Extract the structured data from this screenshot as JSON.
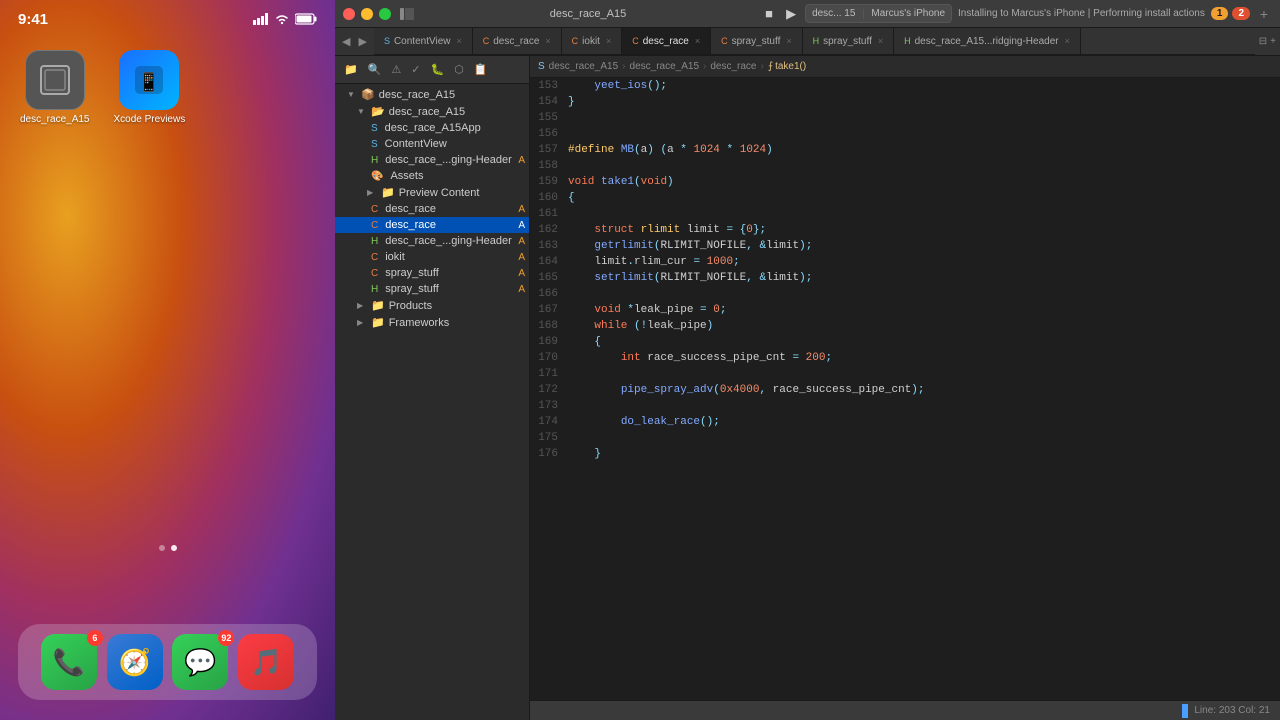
{
  "ios": {
    "status_bar": {
      "time": "9:41",
      "signal_bars": "●●●●",
      "wifi": "wifi",
      "battery": "battery"
    },
    "apps": [
      {
        "id": "desc_race_a15",
        "label": "desc_race_A15",
        "color": "#555",
        "icon": "🔲",
        "badge": null
      },
      {
        "id": "xcode_previews",
        "label": "Xcode Previews",
        "color": "#0078d4",
        "icon": "📱",
        "badge": null
      }
    ],
    "dock": [
      {
        "id": "phone",
        "icon": "📞",
        "color": "#30d158",
        "badge": "6"
      },
      {
        "id": "safari",
        "icon": "🧭",
        "color": "#0066cc",
        "badge": null
      },
      {
        "id": "messages",
        "icon": "💬",
        "color": "#30d158",
        "badge": "92"
      },
      {
        "id": "music",
        "icon": "🎵",
        "color": "#fc3c44",
        "badge": null
      }
    ]
  },
  "xcode": {
    "window_title": "desc_race_A15",
    "traffic_lights": {
      "red": "#ff5f57",
      "yellow": "#febc2e",
      "green": "#28c840"
    },
    "toolbar": {
      "stop_label": "■",
      "play_label": "▶",
      "scheme": "desc_race_A15",
      "device": "desc... 15",
      "target": "Marcus's iPhone",
      "status": "Installing to Marcus's iPhone | Performing install actions",
      "warning_count": "1",
      "error_count": "2"
    },
    "sidebar": {
      "root": "desc_race_A15",
      "items": [
        {
          "level": 0,
          "label": "desc_race_A15",
          "type": "folder",
          "expanded": true,
          "badge": ""
        },
        {
          "level": 1,
          "label": "desc_race_A15",
          "type": "folder",
          "expanded": true,
          "badge": ""
        },
        {
          "level": 2,
          "label": "desc_race_A15App",
          "type": "swift",
          "badge": ""
        },
        {
          "level": 2,
          "label": "ContentView",
          "type": "swift",
          "badge": ""
        },
        {
          "level": 2,
          "label": "desc_race_...ging-Header",
          "type": "h",
          "badge": "A"
        },
        {
          "level": 2,
          "label": "Assets",
          "type": "assets",
          "badge": ""
        },
        {
          "level": 2,
          "label": "Preview Content",
          "type": "folder",
          "expanded": false,
          "badge": ""
        },
        {
          "level": 2,
          "label": "desc_race",
          "type": "c",
          "badge": "A",
          "selected": false
        },
        {
          "level": 2,
          "label": "desc_race",
          "type": "c",
          "badge": "A",
          "selected": true
        },
        {
          "level": 2,
          "label": "desc_race_...ging-Header",
          "type": "h",
          "badge": "A"
        },
        {
          "level": 2,
          "label": "iokit",
          "type": "c",
          "badge": "A"
        },
        {
          "level": 2,
          "label": "spray_stuff",
          "type": "c",
          "badge": "A"
        },
        {
          "level": 2,
          "label": "spray_stuff",
          "type": "h",
          "badge": "A"
        },
        {
          "level": 1,
          "label": "Products",
          "type": "folder",
          "expanded": false,
          "badge": ""
        },
        {
          "level": 1,
          "label": "Frameworks",
          "type": "folder",
          "expanded": false,
          "badge": ""
        }
      ]
    },
    "tabs": [
      {
        "label": "ContentView",
        "icon": "swift",
        "active": false
      },
      {
        "label": "desc_race",
        "icon": "c",
        "active": false
      },
      {
        "label": "iokit",
        "icon": "c",
        "active": false
      },
      {
        "label": "desc_race",
        "icon": "c",
        "active": true
      },
      {
        "label": "spray_stuff",
        "icon": "c",
        "active": false
      },
      {
        "label": "spray_stuff",
        "icon": "h",
        "active": false
      },
      {
        "label": "desc_race_A15...ridging-Header",
        "icon": "h",
        "active": false
      }
    ],
    "breadcrumb": [
      "desc_race_A15",
      "desc_race_A15",
      "desc_race",
      "take1()"
    ],
    "code_lines": [
      {
        "num": 153,
        "content": "    yeet_ios();"
      },
      {
        "num": 154,
        "content": "}"
      },
      {
        "num": 155,
        "content": ""
      },
      {
        "num": 156,
        "content": ""
      },
      {
        "num": 157,
        "content": "#define MB(a) (a * 1024 * 1024)"
      },
      {
        "num": 158,
        "content": ""
      },
      {
        "num": 159,
        "content": "void take1(void)"
      },
      {
        "num": 160,
        "content": "{"
      },
      {
        "num": 161,
        "content": ""
      },
      {
        "num": 162,
        "content": "    struct rlimit limit = {0};"
      },
      {
        "num": 163,
        "content": "    getrlimit(RLIMIT_NOFILE, &limit);"
      },
      {
        "num": 164,
        "content": "    limit.rlim_cur = 1000;"
      },
      {
        "num": 165,
        "content": "    setrlimit(RLIMIT_NOFILE, &limit);"
      },
      {
        "num": 166,
        "content": ""
      },
      {
        "num": 167,
        "content": "    void *leak_pipe = 0;"
      },
      {
        "num": 168,
        "content": "    while (!leak_pipe)"
      },
      {
        "num": 169,
        "content": "    {"
      },
      {
        "num": 170,
        "content": "        int race_success_pipe_cnt = 200;"
      },
      {
        "num": 171,
        "content": ""
      },
      {
        "num": 172,
        "content": "        pipe_spray_adv(0x4000, race_success_pipe_cnt);"
      },
      {
        "num": 173,
        "content": ""
      },
      {
        "num": 174,
        "content": "        do_leak_race();"
      },
      {
        "num": 175,
        "content": ""
      },
      {
        "num": 176,
        "content": "    }"
      }
    ],
    "statusbar": {
      "line": "203",
      "col": "21",
      "text": "Line: 203  Col: 21"
    }
  }
}
